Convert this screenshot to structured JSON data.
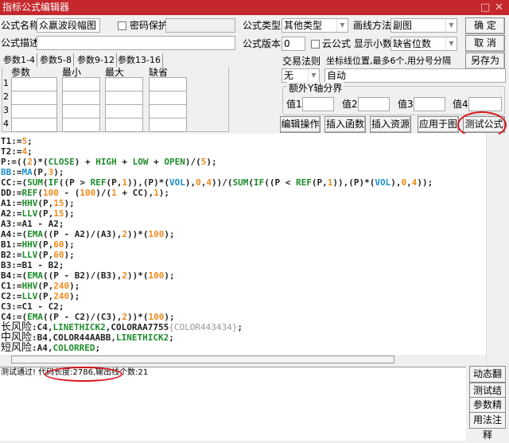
{
  "title": "指标公式编辑器",
  "window_controls": {
    "maximize": "□",
    "close": "✕"
  },
  "form": {
    "name_label": "公式名称",
    "name_value": "众赢波段幅图",
    "password_label": "密码保护",
    "password_checked": false,
    "desc_label": "公式描述",
    "desc_value": "",
    "type_label": "公式类型",
    "type_value": "其他类型",
    "draw_label": "画线方法",
    "draw_value": "副图",
    "version_label": "公式版本",
    "version_value": "0",
    "cloud_label": "云公式",
    "cloud_checked": false,
    "decimals_label": "显示小数",
    "decimals_value": "缺省位数",
    "trade_label": "交易法则",
    "trade_value": "无",
    "axis_label": "坐标线位置,最多6个,用分号分隔",
    "axis_value": "自动",
    "yaxis_group": "额外Y轴分界",
    "y_values": [
      {
        "label": "值1",
        "value": ""
      },
      {
        "label": "值2",
        "value": ""
      },
      {
        "label": "值3",
        "value": ""
      },
      {
        "label": "值4",
        "value": ""
      }
    ]
  },
  "buttons": {
    "ok": "确  定",
    "cancel": "取  消",
    "save_as": "另存为",
    "edit_ops": "编辑操作",
    "insert_func": "插入函数",
    "insert_res": "插入资源",
    "apply_chart": "应用于图",
    "test_formula": "测试公式"
  },
  "param_tabs": [
    "参数1-4",
    "参数5-8",
    "参数9-12",
    "参数13-16"
  ],
  "param_headers": [
    "参数",
    "最小",
    "最大",
    "缺省"
  ],
  "param_rows": [
    "1",
    "2",
    "3",
    "4"
  ],
  "code_lines": [
    [
      [
        "T1:=",
        "d"
      ],
      [
        "5",
        "n"
      ],
      [
        ";",
        "d"
      ]
    ],
    [
      [
        "T2:=",
        "d"
      ],
      [
        "4",
        "n"
      ],
      [
        ";",
        "d"
      ]
    ],
    [
      [
        "P:=((",
        "d"
      ],
      [
        "2",
        "n"
      ],
      [
        ")*(",
        "d"
      ],
      [
        "CLOSE",
        "f"
      ],
      [
        ") + ",
        "d"
      ],
      [
        "HIGH",
        "f"
      ],
      [
        " + ",
        "d"
      ],
      [
        "LOW",
        "f"
      ],
      [
        " + ",
        "d"
      ],
      [
        "OPEN",
        "f"
      ],
      [
        ")/(",
        "d"
      ],
      [
        "5",
        "n"
      ],
      [
        ");",
        "d"
      ]
    ],
    [
      [
        "BB",
        "v"
      ],
      [
        ":=",
        "d"
      ],
      [
        "MA",
        "v"
      ],
      [
        "(P,",
        "d"
      ],
      [
        "3",
        "n"
      ],
      [
        ");",
        "d"
      ]
    ],
    [
      [
        "CC:=(",
        "d"
      ],
      [
        "SUM",
        "f"
      ],
      [
        "(",
        "d"
      ],
      [
        "IF",
        "f"
      ],
      [
        "((P > ",
        "d"
      ],
      [
        "REF",
        "f"
      ],
      [
        "(P,",
        "d"
      ],
      [
        "1",
        "n"
      ],
      [
        ")),(P)*(",
        "d"
      ],
      [
        "VOL",
        "v"
      ],
      [
        "),",
        "d"
      ],
      [
        "0",
        "n"
      ],
      [
        ",",
        "d"
      ],
      [
        "4",
        "n"
      ],
      [
        "))/(",
        "d"
      ],
      [
        "SUM",
        "f"
      ],
      [
        "(",
        "d"
      ],
      [
        "IF",
        "f"
      ],
      [
        "((P < ",
        "d"
      ],
      [
        "REF",
        "f"
      ],
      [
        "(P,",
        "d"
      ],
      [
        "1",
        "n"
      ],
      [
        ")),(P)*(",
        "d"
      ],
      [
        "VOL",
        "v"
      ],
      [
        "),",
        "d"
      ],
      [
        "0",
        "n"
      ],
      [
        ",",
        "d"
      ],
      [
        "4",
        "n"
      ],
      [
        "));",
        "d"
      ]
    ],
    [
      [
        "DD:=",
        "d"
      ],
      [
        "REF",
        "f"
      ],
      [
        "(",
        "d"
      ],
      [
        "100",
        "n"
      ],
      [
        " - (",
        "d"
      ],
      [
        "100",
        "n"
      ],
      [
        ")/(",
        "d"
      ],
      [
        "1",
        "n"
      ],
      [
        " + CC),",
        "d"
      ],
      [
        "1",
        "n"
      ],
      [
        ");",
        "d"
      ]
    ],
    [
      [
        "A1:=",
        "d"
      ],
      [
        "HHV",
        "f"
      ],
      [
        "(P,",
        "d"
      ],
      [
        "15",
        "n"
      ],
      [
        ");",
        "d"
      ]
    ],
    [
      [
        "A2:=",
        "d"
      ],
      [
        "LLV",
        "f"
      ],
      [
        "(P,",
        "d"
      ],
      [
        "15",
        "n"
      ],
      [
        ");",
        "d"
      ]
    ],
    [
      [
        "A3:=A1 - A2;",
        "d"
      ]
    ],
    [
      [
        "A4:=(",
        "d"
      ],
      [
        "EMA",
        "f"
      ],
      [
        "((P - A2)/(A3),",
        "d"
      ],
      [
        "2",
        "n"
      ],
      [
        "))*(",
        "d"
      ],
      [
        "100",
        "n"
      ],
      [
        ");",
        "d"
      ]
    ],
    [
      [
        "B1:=",
        "d"
      ],
      [
        "HHV",
        "f"
      ],
      [
        "(P,",
        "d"
      ],
      [
        "60",
        "n"
      ],
      [
        ");",
        "d"
      ]
    ],
    [
      [
        "B2:=",
        "d"
      ],
      [
        "LLV",
        "f"
      ],
      [
        "(P,",
        "d"
      ],
      [
        "60",
        "n"
      ],
      [
        ");",
        "d"
      ]
    ],
    [
      [
        "B3:=B1 - B2;",
        "d"
      ]
    ],
    [
      [
        "B4:=(",
        "d"
      ],
      [
        "EMA",
        "f"
      ],
      [
        "((P - B2)/(B3),",
        "d"
      ],
      [
        "2",
        "n"
      ],
      [
        "))*(",
        "d"
      ],
      [
        "100",
        "n"
      ],
      [
        ");",
        "d"
      ]
    ],
    [
      [
        "C1:=",
        "d"
      ],
      [
        "HHV",
        "f"
      ],
      [
        "(P,",
        "d"
      ],
      [
        "240",
        "n"
      ],
      [
        ");",
        "d"
      ]
    ],
    [
      [
        "C2:=",
        "d"
      ],
      [
        "LLV",
        "f"
      ],
      [
        "(P,",
        "d"
      ],
      [
        "240",
        "n"
      ],
      [
        ");",
        "d"
      ]
    ],
    [
      [
        "C3:=C1 - C2;",
        "d"
      ]
    ],
    [
      [
        "C4:=(",
        "d"
      ],
      [
        "EMA",
        "f"
      ],
      [
        "((P - C2)/(C3),",
        "d"
      ],
      [
        "2",
        "n"
      ],
      [
        "))*(",
        "d"
      ],
      [
        "100",
        "n"
      ],
      [
        ");",
        "d"
      ]
    ],
    [
      [
        "长风险",
        "z"
      ],
      [
        ":C4,",
        "d"
      ],
      [
        "LINETHICK2",
        "f"
      ],
      [
        ",COLORAA7755",
        "d"
      ],
      [
        "{COLOR443434}",
        "c"
      ],
      [
        ";",
        "d"
      ]
    ],
    [
      [
        "中风险",
        "z"
      ],
      [
        ":B4,COLOR44AABB,",
        "d"
      ],
      [
        "LINETHICK2",
        "f"
      ],
      [
        ";",
        "d"
      ]
    ],
    [
      [
        "短风险",
        "z"
      ],
      [
        ":A4,",
        "d"
      ],
      [
        "COLORRED",
        "f"
      ],
      [
        ";",
        "d"
      ]
    ]
  ],
  "status_text": "测试通过! 代码长度:2786,输出线个数:21",
  "side_buttons": [
    "动态翻译",
    "测试结果",
    "参数精灵",
    "用法注释"
  ],
  "colors": {
    "titlebar": "#c4282c",
    "function": "#1c8c2a",
    "number": "#f08a1c",
    "variable": "#1d8fd0",
    "highlight_ring": "#d8181e"
  }
}
